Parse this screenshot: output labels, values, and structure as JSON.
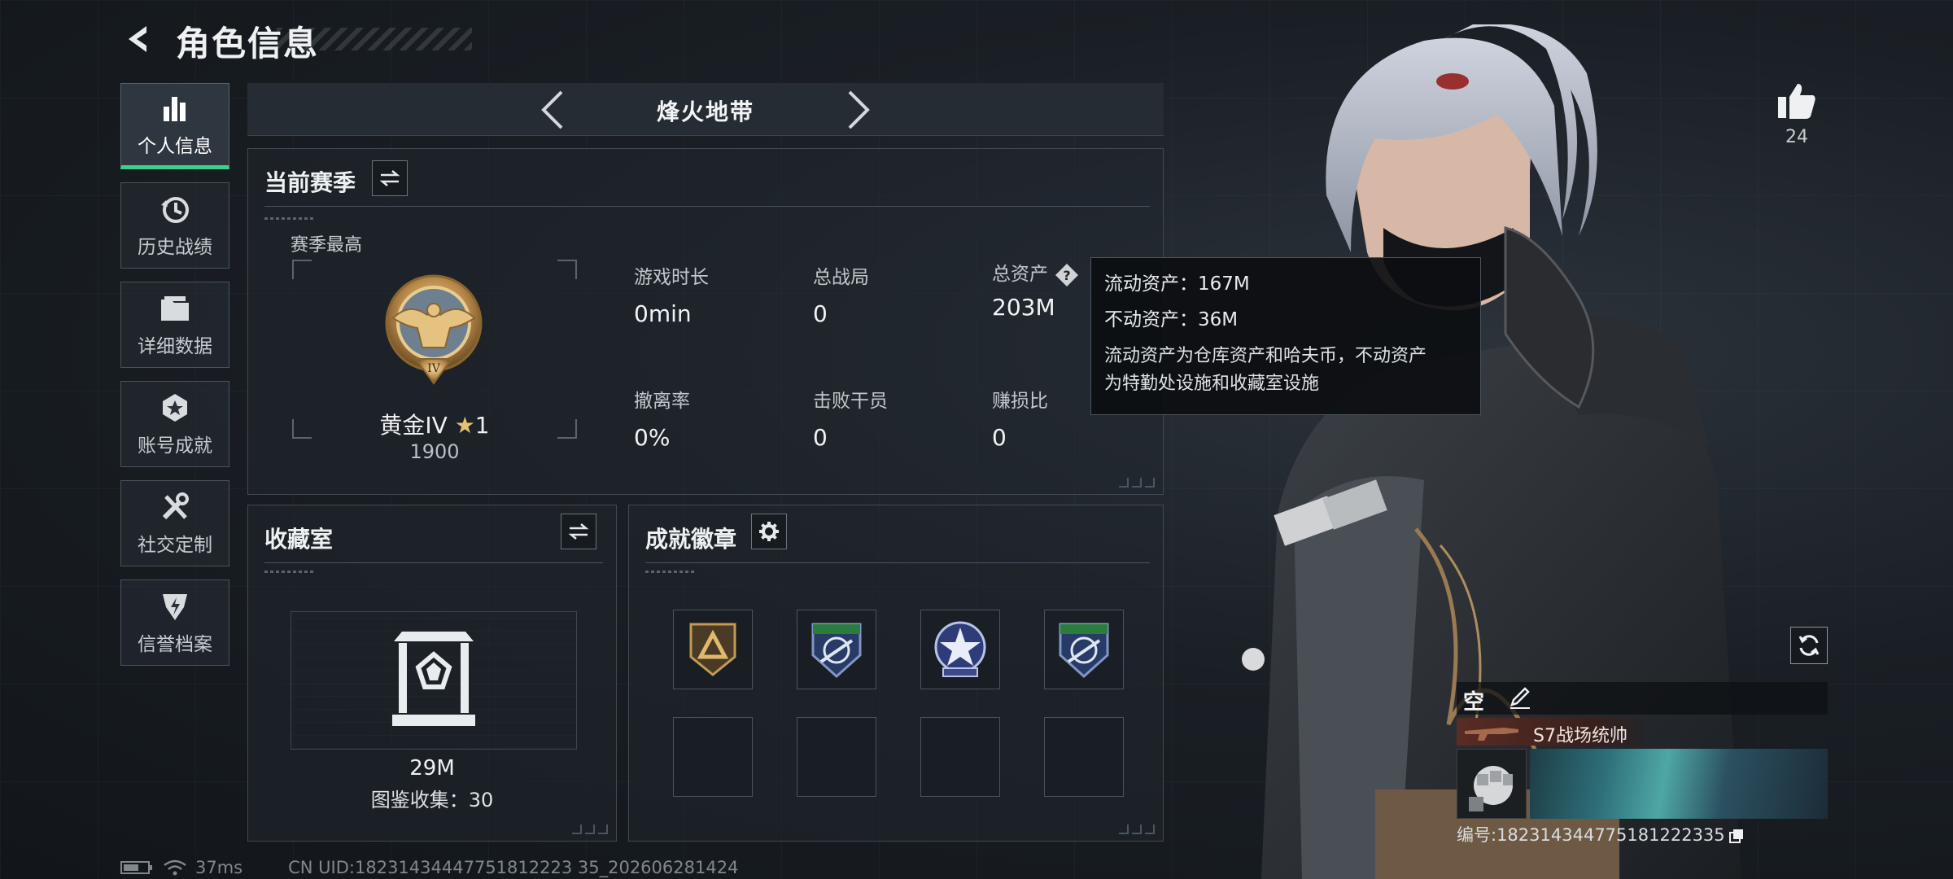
{
  "header": {
    "title": "角色信息"
  },
  "nav": {
    "items": [
      {
        "label": "个人信息",
        "icon": "bar-chart-icon",
        "active": true
      },
      {
        "label": "历史战绩",
        "icon": "history-icon"
      },
      {
        "label": "详细数据",
        "icon": "folder-icon"
      },
      {
        "label": "账号成就",
        "icon": "achievement-icon"
      },
      {
        "label": "社交定制",
        "icon": "tools-icon"
      },
      {
        "label": "信誉档案",
        "icon": "shield-icon"
      }
    ]
  },
  "mode": {
    "title": "烽火地带"
  },
  "season": {
    "title": "当前赛季",
    "subtitle": "赛季最高",
    "rank_name": "黄金IV",
    "rank_stars": "1",
    "rank_score": "1900",
    "stats": [
      {
        "label": "游戏时长",
        "value": "0min"
      },
      {
        "label": "总战局",
        "value": "0"
      },
      {
        "label": "总资产",
        "value": "203M"
      },
      {
        "label": "撤离率",
        "value": "0%"
      },
      {
        "label": "击败干员",
        "value": "0"
      },
      {
        "label": "赚损比",
        "value": "0"
      }
    ]
  },
  "tooltip": {
    "liquid": "流动资产：167M",
    "fixed": "不动资产：36M",
    "desc_line1": "流动资产为仓库资产和哈夫币，不动资产",
    "desc_line2": "为特勤处设施和收藏室设施"
  },
  "collection": {
    "title": "收藏室",
    "value": "29M",
    "count": "图鉴收集：30"
  },
  "badges": {
    "title": "成就徽章",
    "slots": [
      "triangle-badge-icon",
      "rifle-badge-icon",
      "star-badge-icon",
      "rifle-badge-icon",
      "",
      "",
      "",
      ""
    ]
  },
  "likes": {
    "count": "24"
  },
  "card": {
    "name": "空",
    "title": "S7战场统帅",
    "number": "编号:18231434477518122233​5"
  },
  "status": {
    "ping": "37ms",
    "uid": "CN UID:18231434447751812223 35_202606281424"
  }
}
